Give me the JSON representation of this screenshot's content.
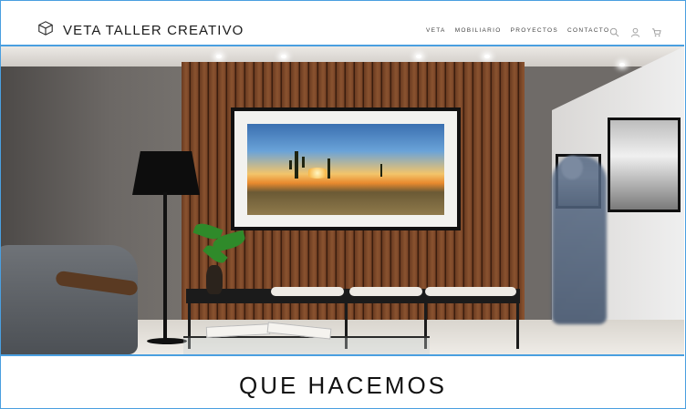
{
  "header": {
    "brand": "VETA TALLER CREATIVO",
    "logo_icon": "cube-outline-icon",
    "nav": [
      {
        "label": "VETA"
      },
      {
        "label": "MOBILIARIO"
      },
      {
        "label": "PROYECTOS"
      },
      {
        "label": "CONTACTO"
      }
    ],
    "icons": [
      "search-icon",
      "user-icon",
      "cart-icon"
    ]
  },
  "hero": {
    "image_icon": "interior-render-image"
  },
  "section": {
    "title": "QUE HACEMOS"
  },
  "colors": {
    "accent_border": "#4a9fe0",
    "text": "#1a1a1a",
    "background": "#ffffff"
  }
}
